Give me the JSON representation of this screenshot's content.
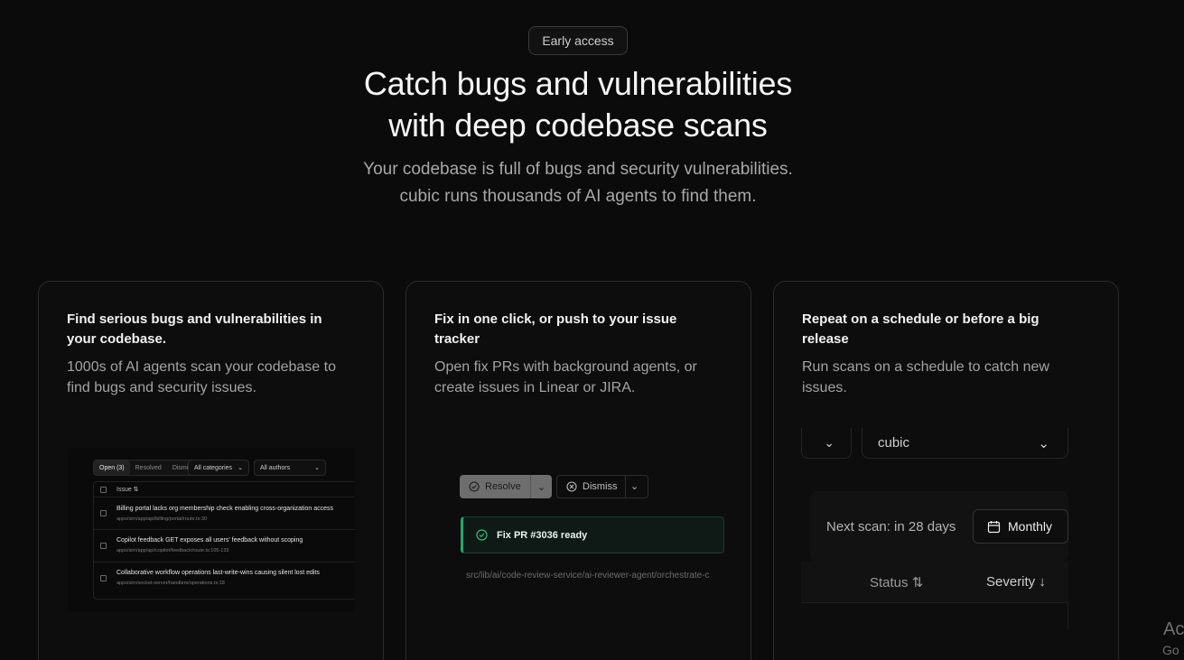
{
  "badge": "Early access",
  "hero": {
    "title_line1": "Catch bugs and vulnerabilities",
    "title_line2": "with deep codebase scans",
    "sub_line1": "Your codebase is full of bugs and security vulnerabilities.",
    "sub_line2": "cubic runs thousands of AI agents to find them."
  },
  "cards": [
    {
      "title": "Find serious bugs and vulnerabilities in your codebase.",
      "desc": "1000s of AI agents scan your codebase to find bugs and security issues.",
      "tabs": [
        "Open (3)",
        "Resolved",
        "Dismissed"
      ],
      "filter_category": "All categories",
      "filter_author": "All authors",
      "column_header": "Issue ⇅",
      "issues": [
        {
          "title": "Billing portal lacks org membership check enabling cross-organization access",
          "path": "apps/sim/app/api/billing/portal/route.ts:30"
        },
        {
          "title": "Copilot feedback GET exposes all users' feedback without scoping",
          "path": "apps/sim/app/api/copilot/feedback/route.ts:105-133"
        },
        {
          "title": "Collaborative workflow operations last-write-wins causing silent lost edits",
          "path": "apps/sim/socket-server/handlers/operations.ts:18"
        }
      ]
    },
    {
      "title": "Fix in one click, or push to your issue tracker",
      "desc": "Open fix PRs with background agents, or create issues in Linear or JIRA.",
      "resolve_label": "Resolve",
      "dismiss_label": "Dismiss",
      "pr_status": "Fix PR #3036 ready",
      "file_path": "src/lib/ai/code-review-service/ai-reviewer-agent/orchestrate-c"
    },
    {
      "title": "Repeat on a schedule or before a big release",
      "desc": "Run scans on a schedule to catch new issues.",
      "repo_select": "cubic",
      "next_scan": "Next scan: in 28 days",
      "frequency": "Monthly",
      "col_status": "Status ⇅",
      "col_severity": "Severity ↓"
    }
  ],
  "overlay": {
    "line1": "Ac",
    "line2": "Go"
  },
  "colors": {
    "background": "#0b0b0b",
    "accent_green": "#21a86e",
    "card_border": "#2b2b2b"
  },
  "icons": [
    "chevron-down-icon",
    "check-circle-icon",
    "x-circle-icon",
    "calendar-icon"
  ]
}
